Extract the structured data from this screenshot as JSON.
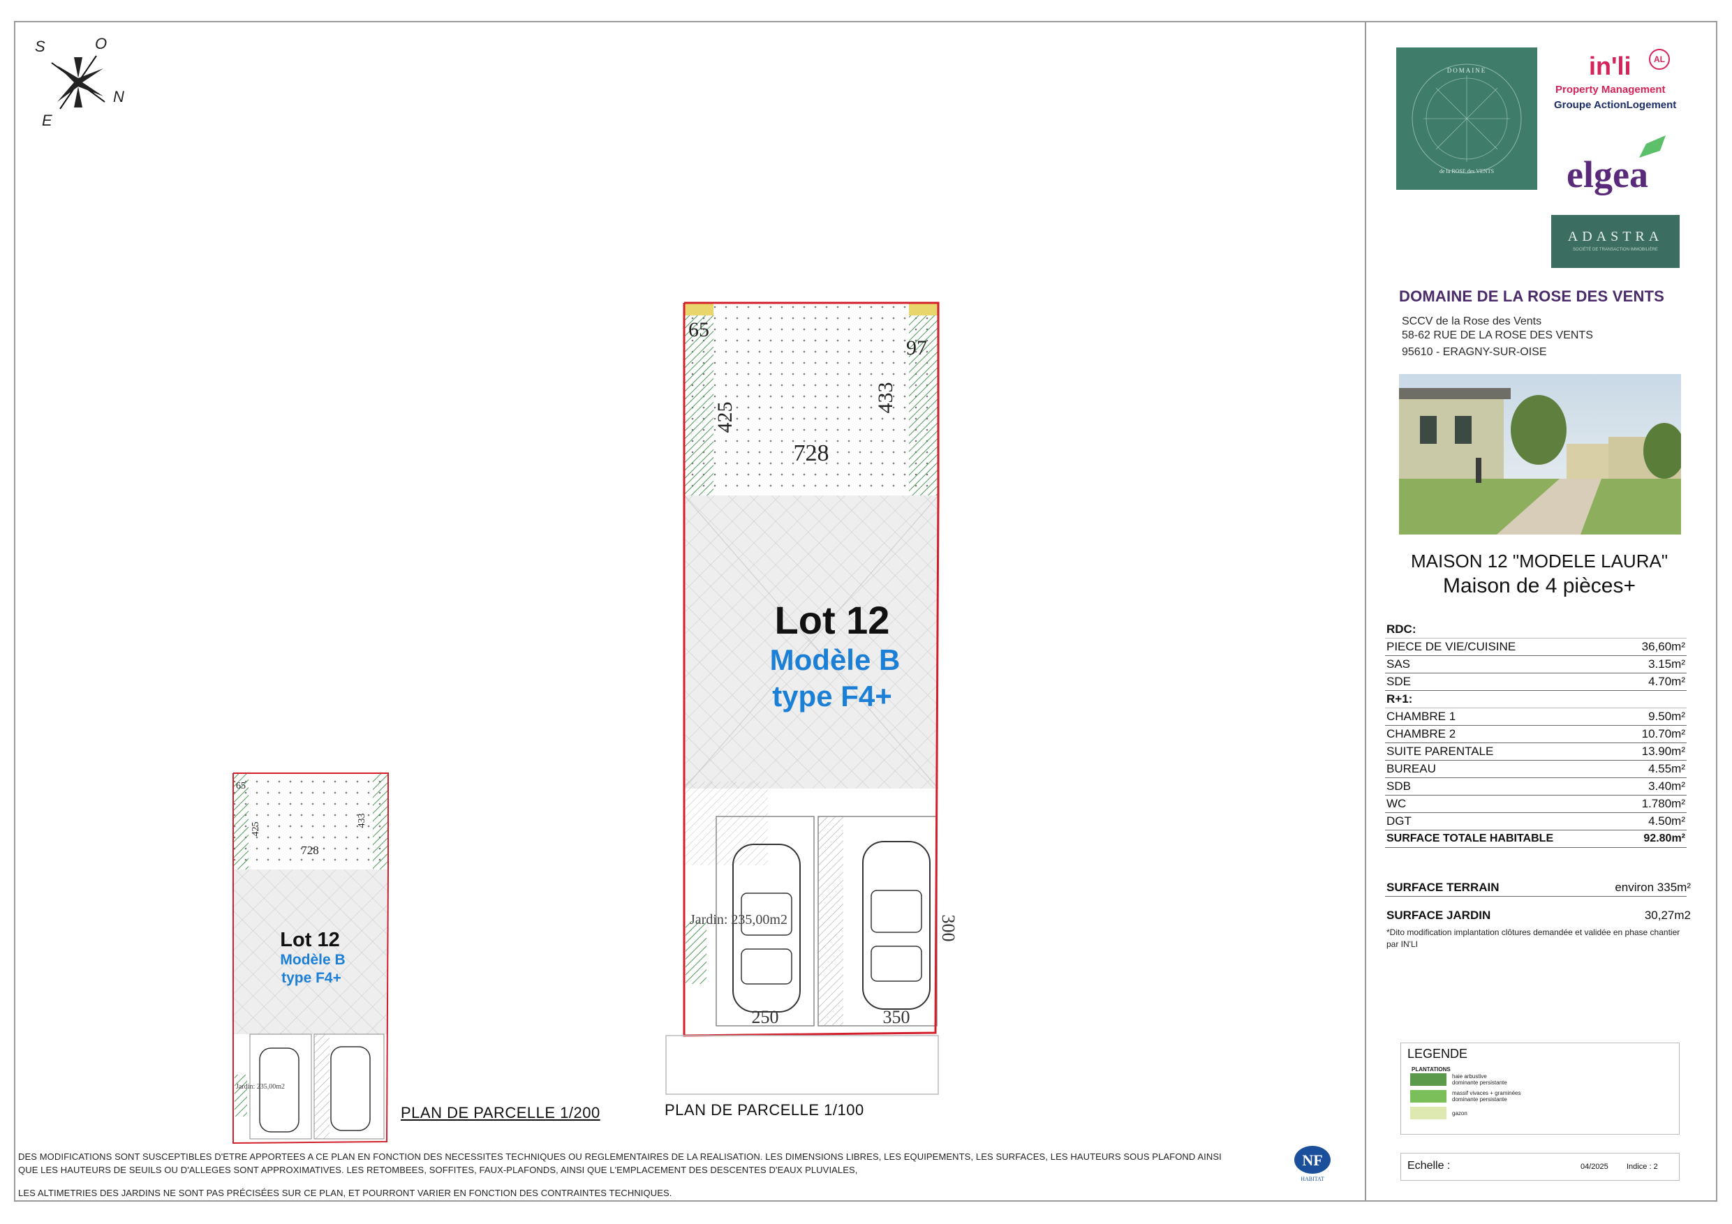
{
  "compass": {
    "s": "S",
    "o": "O",
    "n": "N",
    "e": "E"
  },
  "plan_large": {
    "lot_title": "Lot 12",
    "model": "Modèle B",
    "type": "type F4+",
    "dims": {
      "d65": "65",
      "d97": "97",
      "d425": "425",
      "d433": "433",
      "d728": "728",
      "d300": "300",
      "d250": "250",
      "d350": "350"
    },
    "garden_label": "Jardin: 235,00m2",
    "caption": "PLAN DE PARCELLE 1/100"
  },
  "plan_small": {
    "lot_title": "Lot 12",
    "model": "Modèle B",
    "type": "type F4+",
    "dims": {
      "d65": "65",
      "d425": "425",
      "d433": "433",
      "d728": "728"
    },
    "garden_label": "Jardin: 235,00m2",
    "caption": "PLAN DE PARCELLE 1/200"
  },
  "notes": {
    "line1": "DES MODIFICATIONS SONT SUSCEPTIBLES D'ETRE APPORTEES A CE PLAN EN FONCTION DES NECESSITES TECHNIQUES OU REGLEMENTAIRES DE LA REALISATION. LES DIMENSIONS LIBRES, LES EQUIPEMENTS, LES SURFACES, LES HAUTEURS SOUS PLAFOND AINSI",
    "line2": "QUE LES HAUTEURS DE SEUILS OU D'ALLEGES SONT APPROXIMATIVES. LES RETOMBEES, SOFFITES, FAUX-PLAFONDS, AINSI QUE L'EMPLACEMENT DES DESCENTES D'EAUX PLUVIALES,",
    "line3": "LES ALTIMETRIES DES JARDINS NE SONT PAS PRÉCISÉES SUR CE PLAN, ET POURRONT VARIER EN FONCTION DES CONTRAINTES TECHNIQUES."
  },
  "nf_logo": {
    "mark": "NF",
    "sub": "HABITAT"
  },
  "logos": {
    "domaine_line1": "DOMAINE",
    "domaine_line2": "de la ROSE des VENTS",
    "inli": "in'li",
    "inli_badge": "AL",
    "inli_sub1": "Property Management",
    "inli_sub2": "Groupe ActionLogement",
    "elgea": "elgea",
    "adastra": "ADASTRA",
    "adastra_sub": "SOCIÉTÉ DE TRANSACTION IMMOBILIÈRE"
  },
  "project": {
    "name": "DOMAINE DE LA ROSE DES VENTS",
    "company": "SCCV de la Rose des Vents",
    "street": "58-62 RUE DE LA ROSE DES VENTS",
    "city": "95610 - ERAGNY-SUR-OISE"
  },
  "house": {
    "title": "MAISON 12 \"MODELE LAURA\"",
    "subtitle": "Maison de 4 pièces+"
  },
  "rooms": {
    "rdc_label": "RDC:",
    "rdc": [
      {
        "name": "PIECE DE VIE/CUISINE",
        "area": "36,60m²"
      },
      {
        "name": "SAS",
        "area": "3.15m²"
      },
      {
        "name": "SDE",
        "area": "4.70m²"
      }
    ],
    "r1_label": "R+1:",
    "r1": [
      {
        "name": "CHAMBRE 1",
        "area": "9.50m²"
      },
      {
        "name": "CHAMBRE 2",
        "area": "10.70m²"
      },
      {
        "name": "SUITE PARENTALE",
        "area": "13.90m²"
      },
      {
        "name": "BUREAU",
        "area": "4.55m²"
      },
      {
        "name": "SDB",
        "area": "3.40m²"
      },
      {
        "name": "WC",
        "area": "1.780m²"
      },
      {
        "name": "DGT",
        "area": "4.50m²"
      }
    ],
    "total_label": "SURFACE TOTALE HABITABLE",
    "total_value": "92.80m²"
  },
  "surfaces": {
    "terrain_label": "SURFACE TERRAIN",
    "terrain_value": "environ 335m²",
    "jardin_label": "SURFACE JARDIN",
    "jardin_value": "30,27m2",
    "dito": "*Dito modification implantation clôtures demandée et validée en phase chantier par IN'LI"
  },
  "legend": {
    "title": "LEGENDE",
    "heading": "PLANTATIONS",
    "items": [
      {
        "text1": "haie arbustive",
        "text2": "dominante persistante",
        "color": "#5a9a4a"
      },
      {
        "text1": "massif vivaces + graminées",
        "text2": "dominante persistante",
        "color": "#7bbf5a"
      },
      {
        "text1": "gazon",
        "text2": "",
        "color": "#dde9b0"
      }
    ]
  },
  "footer": {
    "echelle": "Echelle :",
    "date": "04/2025",
    "indice": "Indice : 2"
  }
}
